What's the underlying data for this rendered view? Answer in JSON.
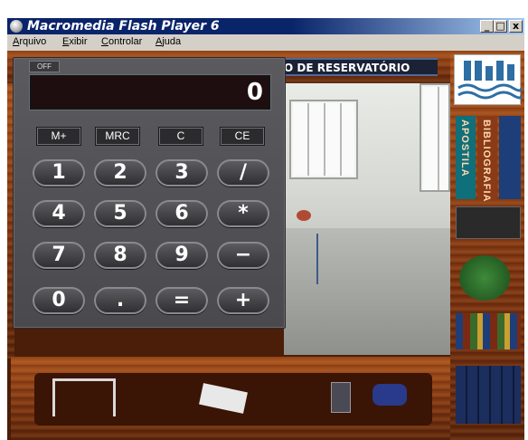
{
  "window": {
    "title": "Macromedia Flash Player 6",
    "minimize": "_",
    "maximize": "□",
    "close": "x"
  },
  "menu": {
    "items": [
      "Arquivo",
      "Exibir",
      "Controlar",
      "Ajuda"
    ]
  },
  "banner": {
    "text": "O DE RESERVATÓRIO"
  },
  "calculator": {
    "off_label": "OFF",
    "display": "0",
    "memory_buttons": [
      "M+",
      "MRC",
      "C",
      "CE"
    ],
    "keys": [
      [
        "1",
        "2",
        "3",
        "/"
      ],
      [
        "4",
        "5",
        "6",
        "*"
      ],
      [
        "7",
        "8",
        "9",
        "−"
      ],
      [
        "0",
        ".",
        "=",
        "+"
      ]
    ]
  },
  "shelf": {
    "books": [
      "APOSTILA",
      "BIBLIOGRAFIA"
    ]
  },
  "colors": {
    "titlebar": "#0a246a",
    "wood": "#7a3210",
    "calculator_body": "#4a4a4e",
    "display_bg": "#1e0e0f"
  }
}
